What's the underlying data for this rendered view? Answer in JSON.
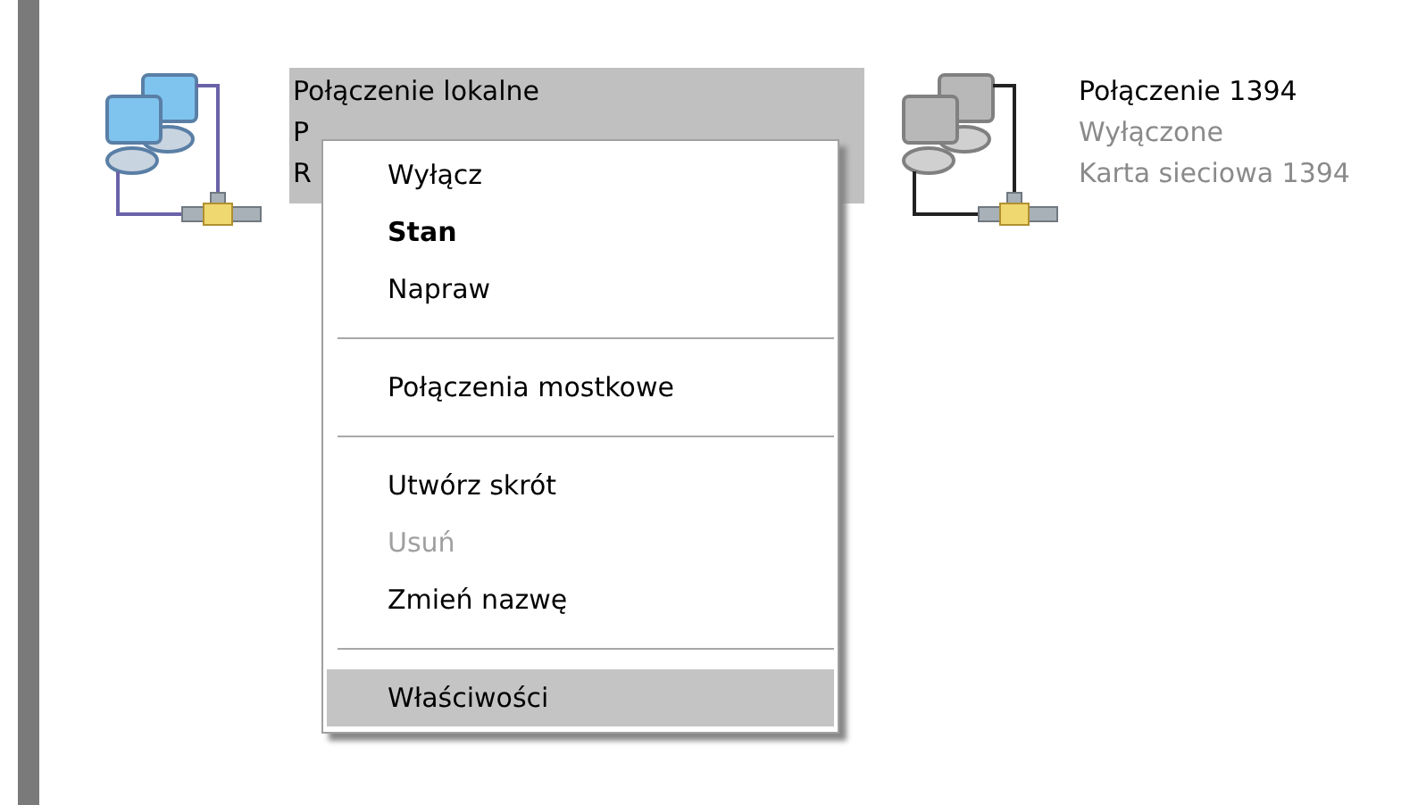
{
  "connections": [
    {
      "lines": [
        "Połączenie lokalne",
        "P",
        "R"
      ],
      "enabled": true,
      "selected": true
    },
    {
      "lines": [
        "Połączenie 1394",
        "Wyłączone",
        "Karta sieciowa 1394"
      ],
      "enabled": false,
      "selected": false
    }
  ],
  "context_menu": [
    {
      "kind": "item",
      "label": "Wyłącz",
      "default": false,
      "disabled": false,
      "selected": false
    },
    {
      "kind": "item",
      "label": "Stan",
      "default": true,
      "disabled": false,
      "selected": false
    },
    {
      "kind": "item",
      "label": "Napraw",
      "default": false,
      "disabled": false,
      "selected": false
    },
    {
      "kind": "separator"
    },
    {
      "kind": "item",
      "label": "Połączenia mostkowe",
      "default": false,
      "disabled": false,
      "selected": false
    },
    {
      "kind": "separator"
    },
    {
      "kind": "item",
      "label": "Utwórz skrót",
      "default": false,
      "disabled": false,
      "selected": false
    },
    {
      "kind": "item",
      "label": "Usuń",
      "default": false,
      "disabled": true,
      "selected": false
    },
    {
      "kind": "item",
      "label": "Zmień nazwę",
      "default": false,
      "disabled": false,
      "selected": false
    },
    {
      "kind": "separator"
    },
    {
      "kind": "item",
      "label": "Właściwości",
      "default": false,
      "disabled": false,
      "selected": true
    }
  ]
}
